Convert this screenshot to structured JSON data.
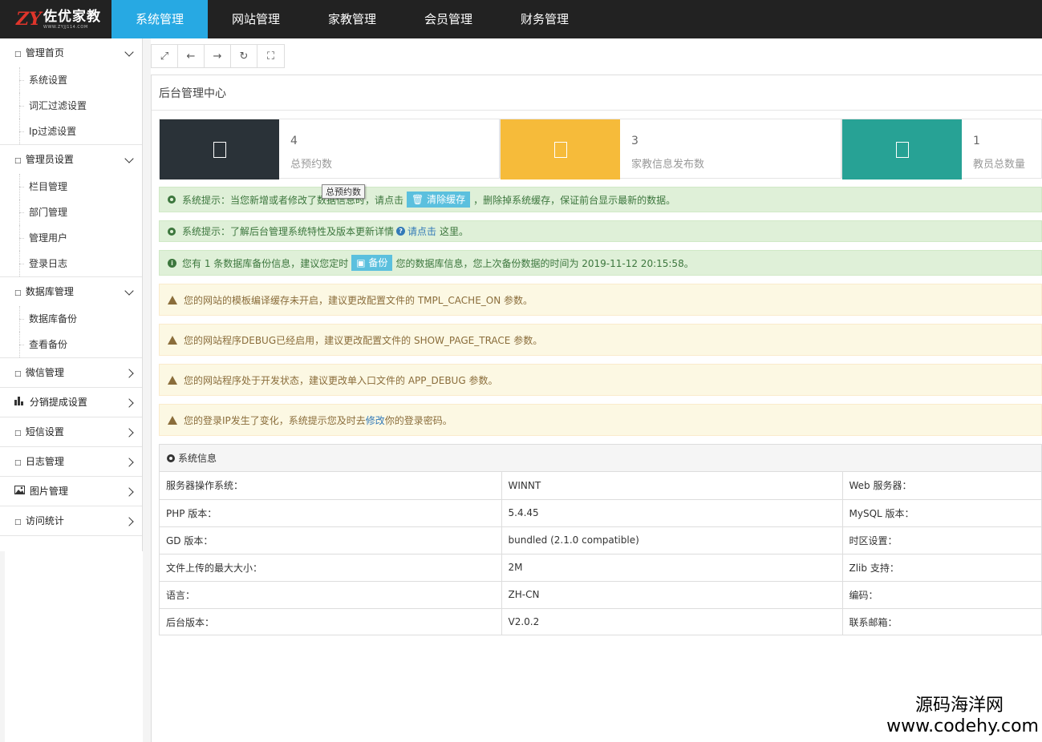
{
  "brand": {
    "logo_mark": "ZY",
    "name": "佐优家教",
    "url_text": "WWW.ZYJJ114.COM"
  },
  "nav": [
    {
      "label": "系统管理",
      "active": true
    },
    {
      "label": "网站管理"
    },
    {
      "label": "家教管理"
    },
    {
      "label": "会员管理"
    },
    {
      "label": "财务管理"
    }
  ],
  "sidebar": {
    "groups": [
      {
        "label": "管理首页",
        "icon": "square-icon",
        "expanded": true,
        "items": [
          "系统设置",
          "词汇过滤设置",
          "Ip过滤设置"
        ]
      },
      {
        "label": "管理员设置",
        "icon": "square-icon",
        "expanded": true,
        "items": [
          "栏目管理",
          "部门管理",
          "管理用户",
          "登录日志"
        ]
      },
      {
        "label": "数据库管理",
        "icon": "square-icon",
        "expanded": true,
        "items": [
          "数据库备份",
          "查看备份"
        ]
      },
      {
        "label": "微信管理",
        "icon": "square-icon",
        "expanded": false
      },
      {
        "label": "分销提成设置",
        "icon": "bar-chart-icon",
        "expanded": false
      },
      {
        "label": "短信设置",
        "icon": "square-icon",
        "expanded": false
      },
      {
        "label": "日志管理",
        "icon": "square-icon",
        "expanded": false
      },
      {
        "label": "图片管理",
        "icon": "picture-icon",
        "expanded": false
      },
      {
        "label": "访问统计",
        "icon": "square-icon",
        "expanded": false
      }
    ]
  },
  "toolbar": [
    "expand-icon",
    "arrow-left-icon",
    "arrow-right-icon",
    "refresh-icon",
    "fullscreen-icon"
  ],
  "page": {
    "title": "后台管理中心"
  },
  "stats": [
    {
      "value": "4",
      "label": "总预约数",
      "color": "#2a3238"
    },
    {
      "value": "3",
      "label": "家教信息发布数",
      "color": "#f6bb3a"
    },
    {
      "value": "1",
      "label": "教员总数量",
      "color": "#27a295"
    }
  ],
  "tooltip": "总预约数",
  "alerts": {
    "cache": {
      "prefix": "系统提示：当您新增或者修改了数据信息时，请点击",
      "button": "清除缓存",
      "suffix": "，删除掉系统缓存，保证前台显示最新的数据。"
    },
    "about": {
      "prefix": "系统提示：了解后台管理系统特性及版本更新详情",
      "link": "请点击",
      "suffix": "这里。"
    },
    "backup": {
      "prefix": "您有 1 条数据库备份信息，建议您定时",
      "button": "备份",
      "suffix": "您的数据库信息，您上次备份数据的时间为 2019-11-12 20:15:58。"
    },
    "warn1": "您的网站的模板编译缓存未开启，建议更改配置文件的 TMPL_CACHE_ON 参数。",
    "warn2": "您的网站程序DEBUG已经启用，建议更改配置文件的 SHOW_PAGE_TRACE 参数。",
    "warn3": "您的网站程序处于开发状态，建议更改单入口文件的 APP_DEBUG 参数。",
    "warn4": {
      "prefix": "您的登录IP发生了变化，系统提示您及时去",
      "link": "修改",
      "suffix": "你的登录密码。"
    }
  },
  "sysinfo": {
    "title": "系统信息",
    "rows": [
      [
        "服务器操作系统：",
        "WINNT",
        "Web 服务器："
      ],
      [
        "PHP 版本：",
        "5.4.45",
        "MySQL 版本："
      ],
      [
        "GD 版本：",
        "bundled (2.1.0 compatible)",
        "时区设置："
      ],
      [
        "文件上传的最大大小：",
        "2M",
        "Zlib 支持："
      ],
      [
        "语言：",
        "ZH-CN",
        "编码："
      ],
      [
        "后台版本：",
        "V2.0.2",
        "联系邮箱："
      ]
    ]
  },
  "watermark": {
    "cn": "源码海洋网",
    "en": "www.codehy.com"
  }
}
